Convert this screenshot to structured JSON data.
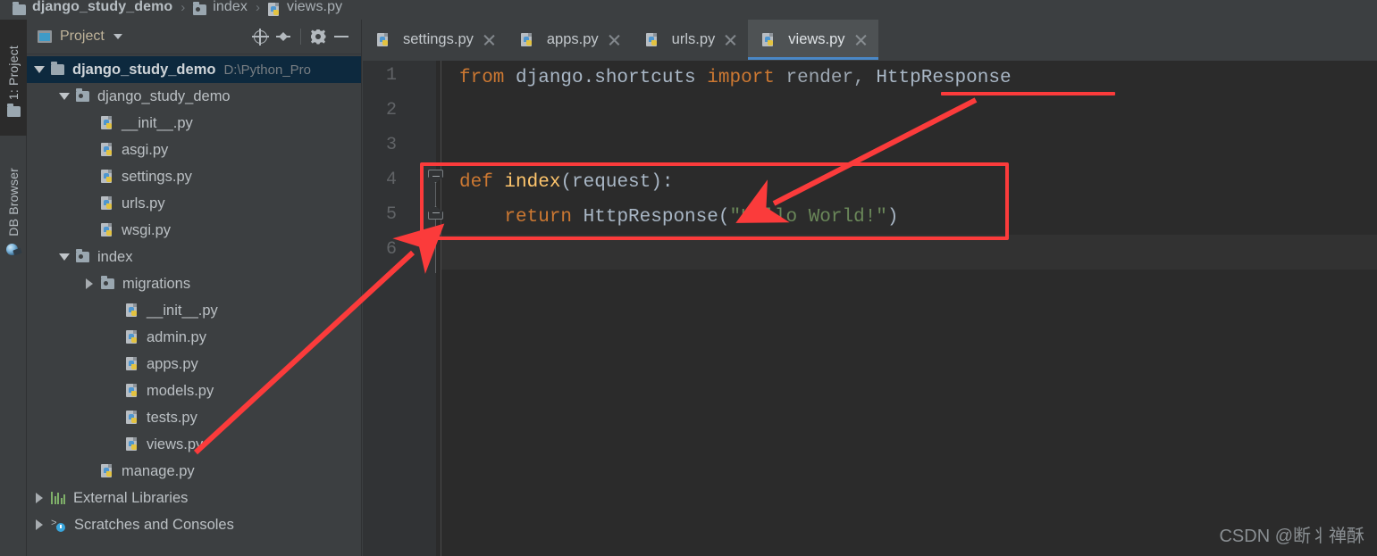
{
  "breadcrumb": {
    "items": [
      {
        "label": "django_study_demo",
        "icon": "folder-icon",
        "bold": true
      },
      {
        "label": "index",
        "icon": "package-folder-icon",
        "bold": false
      },
      {
        "label": "views.py",
        "icon": "python-file-icon",
        "bold": false
      }
    ],
    "separator": "›"
  },
  "toolstrip": {
    "tabs": [
      {
        "label": "1: Project",
        "icon": "folder-icon",
        "active": true
      },
      {
        "label": "DB Browser",
        "icon": "db-browser-icon",
        "active": false
      }
    ]
  },
  "project_panel": {
    "title": "Project",
    "title_icon": "project-window-icon",
    "dropdown_icon": "chevron-down-icon",
    "actions": [
      {
        "name": "scroll-from-source-icon",
        "label": "Select Opened File"
      },
      {
        "name": "collapse-all-icon",
        "label": "Collapse All"
      },
      {
        "name": "gear-icon",
        "label": "Settings"
      },
      {
        "name": "minimize-icon",
        "label": "Hide"
      }
    ],
    "tree": [
      {
        "label": "django_study_demo",
        "path": "D:\\Python_Pro",
        "indent": 0,
        "toggle": "expanded",
        "icon": "folder-icon",
        "bold": true,
        "selected": true
      },
      {
        "label": "django_study_demo",
        "path": "",
        "indent": 1,
        "toggle": "expanded",
        "icon": "package-folder-icon",
        "bold": false,
        "selected": false
      },
      {
        "label": "__init__.py",
        "path": "",
        "indent": 2,
        "toggle": "none",
        "icon": "python-file-icon",
        "bold": false,
        "selected": false
      },
      {
        "label": "asgi.py",
        "path": "",
        "indent": 2,
        "toggle": "none",
        "icon": "python-file-icon",
        "bold": false,
        "selected": false
      },
      {
        "label": "settings.py",
        "path": "",
        "indent": 2,
        "toggle": "none",
        "icon": "python-file-icon",
        "bold": false,
        "selected": false
      },
      {
        "label": "urls.py",
        "path": "",
        "indent": 2,
        "toggle": "none",
        "icon": "python-file-icon",
        "bold": false,
        "selected": false
      },
      {
        "label": "wsgi.py",
        "path": "",
        "indent": 2,
        "toggle": "none",
        "icon": "python-file-icon",
        "bold": false,
        "selected": false
      },
      {
        "label": "index",
        "path": "",
        "indent": 1,
        "toggle": "expanded",
        "icon": "package-folder-icon",
        "bold": false,
        "selected": false
      },
      {
        "label": "migrations",
        "path": "",
        "indent": 2,
        "toggle": "collapsed",
        "icon": "package-folder-icon",
        "bold": false,
        "selected": false
      },
      {
        "label": "__init__.py",
        "path": "",
        "indent": 3,
        "toggle": "none",
        "icon": "python-file-icon",
        "bold": false,
        "selected": false
      },
      {
        "label": "admin.py",
        "path": "",
        "indent": 3,
        "toggle": "none",
        "icon": "python-file-icon",
        "bold": false,
        "selected": false
      },
      {
        "label": "apps.py",
        "path": "",
        "indent": 3,
        "toggle": "none",
        "icon": "python-file-icon",
        "bold": false,
        "selected": false
      },
      {
        "label": "models.py",
        "path": "",
        "indent": 3,
        "toggle": "none",
        "icon": "python-file-icon",
        "bold": false,
        "selected": false
      },
      {
        "label": "tests.py",
        "path": "",
        "indent": 3,
        "toggle": "none",
        "icon": "python-file-icon",
        "bold": false,
        "selected": false
      },
      {
        "label": "views.py",
        "path": "",
        "indent": 3,
        "toggle": "none",
        "icon": "python-file-icon",
        "bold": false,
        "selected": false
      },
      {
        "label": "manage.py",
        "path": "",
        "indent": 2,
        "toggle": "none",
        "icon": "python-file-icon",
        "bold": false,
        "selected": false
      },
      {
        "label": "External Libraries",
        "path": "",
        "indent": 0,
        "toggle": "collapsed",
        "icon": "external-libraries-icon",
        "bold": false,
        "selected": false
      },
      {
        "label": "Scratches and Consoles",
        "path": "",
        "indent": 0,
        "toggle": "collapsed",
        "icon": "scratches-icon",
        "bold": false,
        "selected": false
      }
    ]
  },
  "editor": {
    "tabs": [
      {
        "label": "settings.py",
        "icon": "python-file-icon",
        "active": false,
        "close_icon": "close-icon"
      },
      {
        "label": "apps.py",
        "icon": "python-file-icon",
        "active": false,
        "close_icon": "close-icon"
      },
      {
        "label": "urls.py",
        "icon": "python-file-icon",
        "active": false,
        "close_icon": "close-icon"
      },
      {
        "label": "views.py",
        "icon": "python-file-icon",
        "active": true,
        "close_icon": "close-icon"
      }
    ],
    "line_numbers": [
      "1",
      "2",
      "3",
      "4",
      "5",
      "6"
    ],
    "current_line": 6,
    "lines": [
      {
        "n": 1,
        "tokens": [
          {
            "t": "from ",
            "c": "kw"
          },
          {
            "t": "django.shortcuts ",
            "c": "pln"
          },
          {
            "t": "import ",
            "c": "kw"
          },
          {
            "t": "render",
            "c": "dim"
          },
          {
            "t": ", ",
            "c": "dim"
          },
          {
            "t": "HttpResponse",
            "c": "cls"
          }
        ]
      },
      {
        "n": 2,
        "tokens": []
      },
      {
        "n": 3,
        "tokens": []
      },
      {
        "n": 4,
        "tokens": [
          {
            "t": "def ",
            "c": "kw"
          },
          {
            "t": "index",
            "c": "fn"
          },
          {
            "t": "(request):",
            "c": "punc"
          }
        ]
      },
      {
        "n": 5,
        "tokens": [
          {
            "t": "    ",
            "c": "pln"
          },
          {
            "t": "return ",
            "c": "kw"
          },
          {
            "t": "HttpResponse",
            "c": "cls"
          },
          {
            "t": "(",
            "c": "punc"
          },
          {
            "t": "\"Hello World!\"",
            "c": "str"
          },
          {
            "t": ")",
            "c": "punc"
          }
        ]
      },
      {
        "n": 6,
        "tokens": []
      }
    ]
  },
  "annotations": {
    "highlight_box_label": "highlighted view function",
    "underline_label": "HttpResponse import underline",
    "arrow_to_code_label": "arrow pointing from HttpResponse import to HttpResponse usage",
    "arrow_to_file_label": "arrow pointing from views.py file to editor"
  },
  "watermark": {
    "text": "CSDN @断丬禅酥"
  },
  "colors": {
    "accent_blue": "#4a88c7",
    "annotation_red": "#fb3b3b",
    "editor_bg": "#2b2b2b",
    "panel_bg": "#3c3f41",
    "selection_blue": "#0d293e",
    "keyword_orange": "#cc7832",
    "string_green": "#6a8759",
    "function_yellow": "#ffc66d"
  }
}
